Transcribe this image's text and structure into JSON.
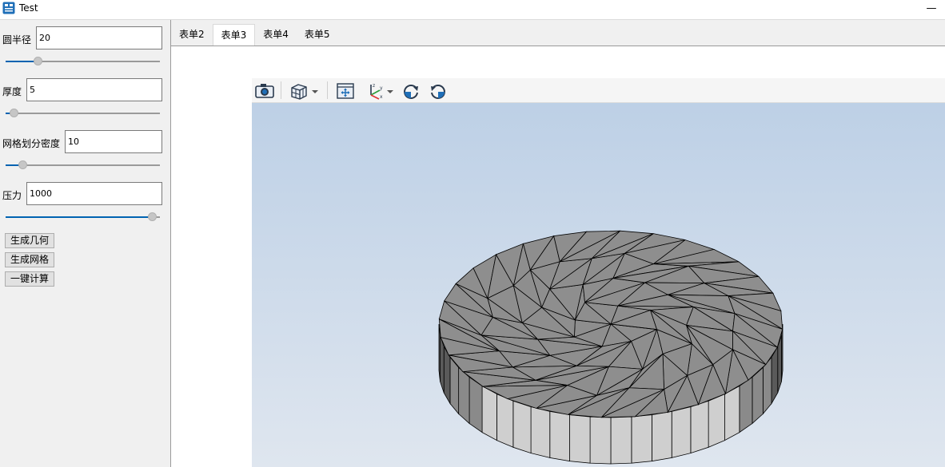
{
  "window": {
    "title": "Test"
  },
  "params": {
    "radius": {
      "label": "圆半径",
      "value": "20",
      "slider": 0.19
    },
    "thickness": {
      "label": "厚度",
      "value": "5",
      "slider": 0.03
    },
    "mesh_density": {
      "label": "网格划分密度",
      "value": "10",
      "slider": 0.09
    },
    "pressure": {
      "label": "压力",
      "value": "1000",
      "slider": 0.98
    }
  },
  "buttons": {
    "gen_geometry": "生成几何",
    "gen_mesh": "生成网格",
    "one_click_compute": "一键计算"
  },
  "tabs": [
    {
      "label": "表单2",
      "active": false
    },
    {
      "label": "表单3",
      "active": true
    },
    {
      "label": "表单4",
      "active": false
    },
    {
      "label": "表单5",
      "active": false
    }
  ],
  "toolbar": {
    "icons": [
      "camera-icon",
      "view-cube-icon",
      "fit-all-icon",
      "axes-icon",
      "rotate-cw-icon",
      "rotate-ccw-icon"
    ],
    "accent": "#1f6fb8"
  },
  "viewport": {
    "background_top": "#bdd0e6",
    "background_bottom": "#dfe6ef",
    "mesh_top_color": "#8e8e8e",
    "mesh_side_color": "#cfcfcf",
    "edge_color": "#000000"
  }
}
